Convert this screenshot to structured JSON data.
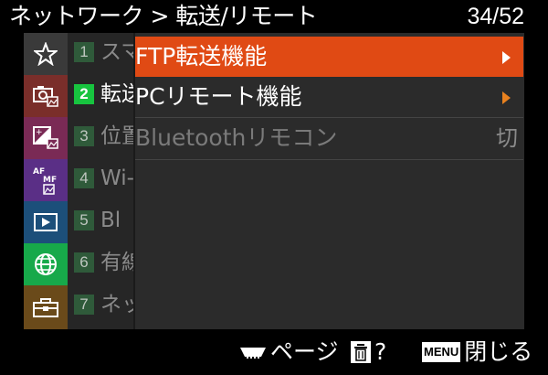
{
  "header": {
    "title": "ネットワーク > 転送/リモート",
    "page": "34/52"
  },
  "categories": [
    {
      "icon": "star-icon",
      "bg": "#3a3a3a"
    },
    {
      "icon": "camera-photo-icon",
      "bg": "#7a2e2a"
    },
    {
      "icon": "exposure-color-icon",
      "bg": "#7a2a55"
    },
    {
      "icon": "af-mf-icon",
      "bg": "#5a2f86"
    },
    {
      "icon": "playback-icon",
      "bg": "#1c4f7a"
    },
    {
      "icon": "network-globe-icon",
      "bg": "#17a94a",
      "active": true
    },
    {
      "icon": "toolbox-icon",
      "bg": "#6a4a1a"
    }
  ],
  "subtabs": [
    {
      "num": "1",
      "label": "スマ"
    },
    {
      "num": "2",
      "label": "転送",
      "active": true
    },
    {
      "num": "3",
      "label": "位置"
    },
    {
      "num": "4",
      "label": "Wi-"
    },
    {
      "num": "5",
      "label": "Bl"
    },
    {
      "num": "6",
      "label": "有線"
    },
    {
      "num": "7",
      "label": "ネッ"
    }
  ],
  "items": [
    {
      "label": "FTP転送機能",
      "selected": true,
      "arrow": true
    },
    {
      "label": "PCリモート機能",
      "arrow": true
    },
    {
      "label": "Bluetoothリモコン",
      "disabled": true,
      "value": "切"
    }
  ],
  "footer": {
    "page_label": "ページ",
    "delete_label": "?",
    "menu_badge": "MENU",
    "close_label": "閉じる"
  }
}
